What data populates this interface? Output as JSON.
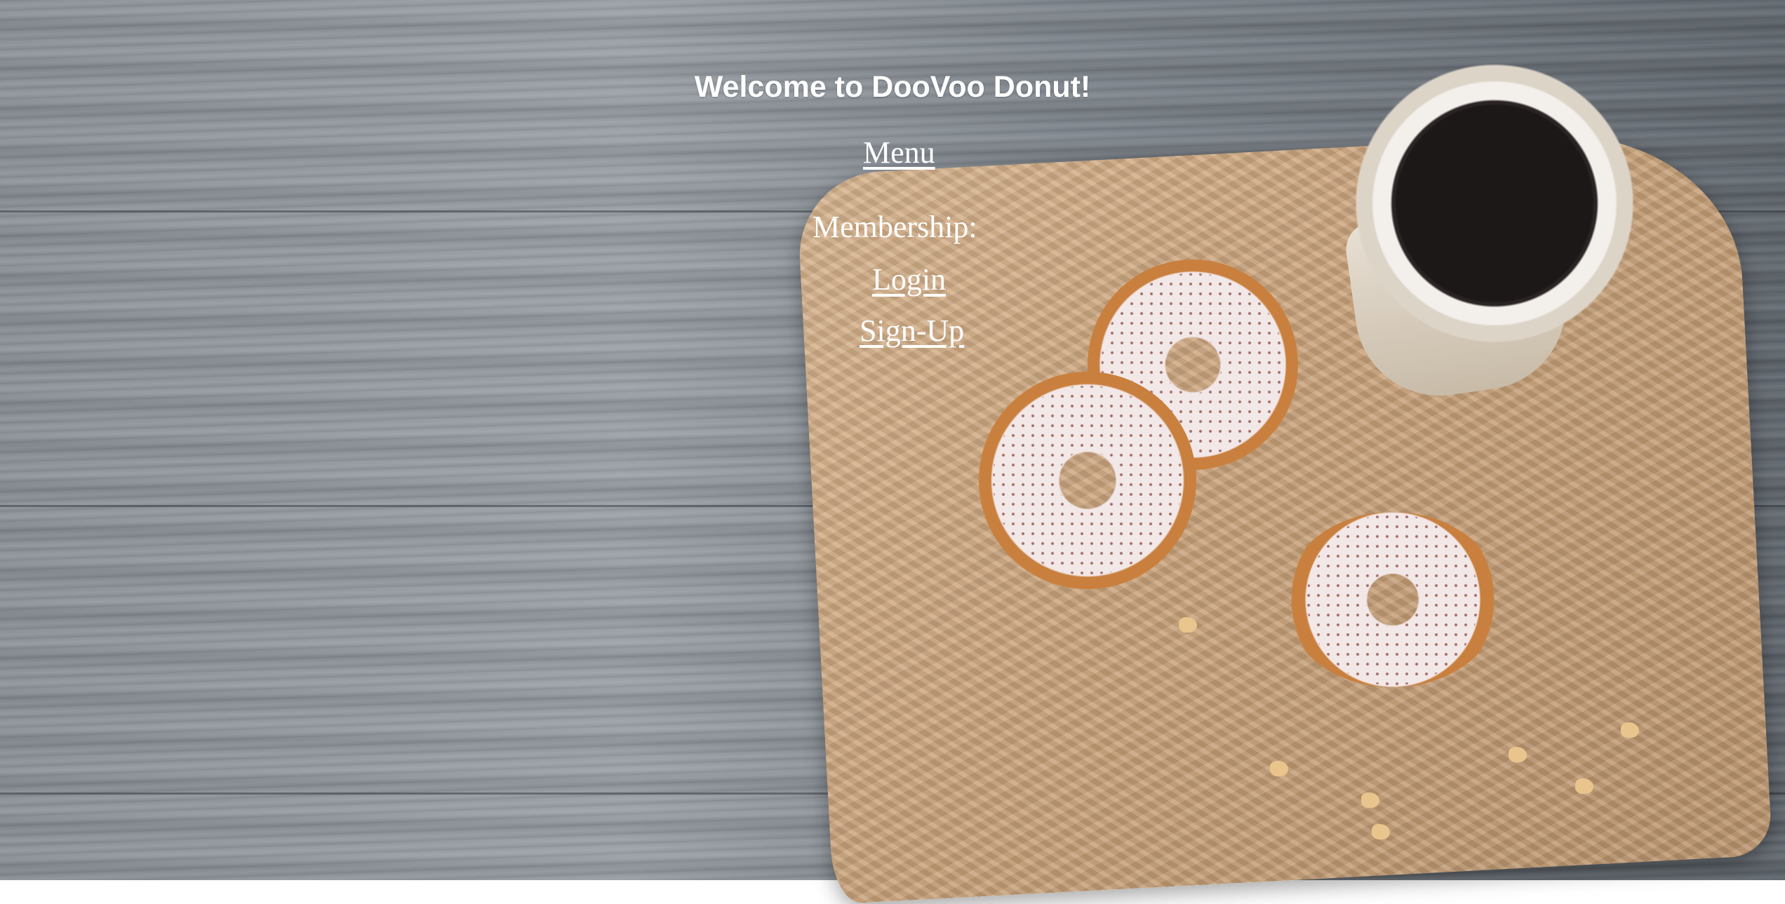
{
  "header": {
    "title": "Welcome to DooVoo Donut!"
  },
  "nav": {
    "menu_label": "Menu ",
    "membership_label": "Membership:",
    "login_label": "Login ",
    "signup_label": "Sign-Up"
  },
  "colors": {
    "text": "#ffffff",
    "wood": "#8b9198",
    "paper": "#c9a27a"
  }
}
